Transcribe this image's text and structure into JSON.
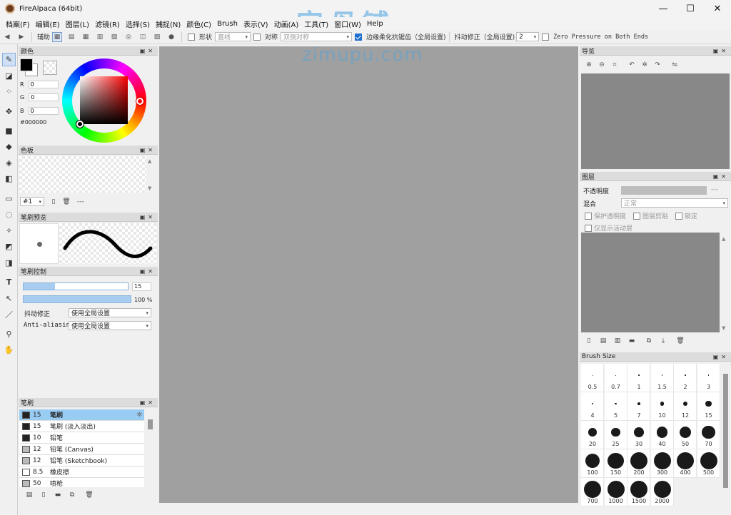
{
  "window": {
    "title": "FireAlpaca (64bit)",
    "minimize": "—",
    "maximize": "☐",
    "close": "✕"
  },
  "menu": [
    "档案(F)",
    "编辑(E)",
    "图层(L)",
    "滤镜(R)",
    "选择(S)",
    "捕捉(N)",
    "颜色(C)",
    "Brush",
    "表示(V)",
    "动画(A)",
    "工具(T)",
    "窗口(W)",
    "Help"
  ],
  "toolbar": {
    "assist_label": "辅助",
    "shape_label": "形状",
    "shape_value": "直线",
    "symmetry_label": "对称",
    "symmetry_value": "双侧对称",
    "edge_aa_label": "边缘柔化抗锯齿（全局设置)",
    "stabilizer_label": "抖动修正（全局设置)",
    "stabilizer_value": "2",
    "zero_pressure_label": "Zero Pressure on Both Ends"
  },
  "watermark": {
    "line1": "字母铺",
    "line2": "zimupu.com"
  },
  "color_panel": {
    "title": "颜色",
    "r_label": "R",
    "r": "0",
    "g_label": "G",
    "g": "0",
    "b_label": "B",
    "b": "0",
    "hex": "#000000"
  },
  "palette_panel": {
    "title": "色板",
    "selector": "#1",
    "dashes": "---"
  },
  "brush_preview_panel": {
    "title": "笔刷预览"
  },
  "brush_control_panel": {
    "title": "笔刷控制",
    "size_value": "15",
    "size_fill": 0.3,
    "opacity_value": "100",
    "opacity_unit": "%",
    "opacity_fill": 1.0,
    "stabilizer_label": "抖动修正",
    "stabilizer_value": "使用全局设置",
    "aa_label": "Anti-aliasin",
    "aa_value": "使用全局设置"
  },
  "brush_list_panel": {
    "title": "笔刷",
    "items": [
      {
        "size": "15",
        "name": "笔刷",
        "color": "#222222",
        "selected": true
      },
      {
        "size": "15",
        "name": "笔刷 (淡入淡出)",
        "color": "#222222",
        "selected": false
      },
      {
        "size": "10",
        "name": "铅笔",
        "color": "#222222",
        "selected": false
      },
      {
        "size": "12",
        "name": "铅笔 (Canvas)",
        "color": "#bbbbbb",
        "selected": false
      },
      {
        "size": "12",
        "name": "铅笔 (Sketchbook)",
        "color": "#bbbbbb",
        "selected": false
      },
      {
        "size": "8.5",
        "name": "橡皮擦",
        "color": "#ffffff",
        "selected": false
      },
      {
        "size": "50",
        "name": "喷枪",
        "color": "#bbbbbb",
        "selected": false
      }
    ]
  },
  "navigator_panel": {
    "title": "导览"
  },
  "layer_panel": {
    "title": "图层",
    "opacity_label": "不透明度",
    "opacity_value": "---",
    "blend_label": "混合",
    "blend_value": "正常",
    "protect_alpha": "保护透明度",
    "clipping": "图层剪贴",
    "lock": "锁定",
    "show_active_only": "仅显示活动层"
  },
  "brush_size_panel": {
    "title": "Brush Size",
    "sizes": [
      {
        "label": "0.5",
        "d": 0.5
      },
      {
        "label": "0.7",
        "d": 0.7
      },
      {
        "label": "1",
        "d": 1
      },
      {
        "label": "1.5",
        "d": 1.5
      },
      {
        "label": "2",
        "d": 2
      },
      {
        "label": "3",
        "d": 3
      },
      {
        "label": "4",
        "d": 4
      },
      {
        "label": "5",
        "d": 5
      },
      {
        "label": "7",
        "d": 7
      },
      {
        "label": "10",
        "d": 10
      },
      {
        "label": "12",
        "d": 12
      },
      {
        "label": "15",
        "d": 15
      },
      {
        "label": "20",
        "d": 20
      },
      {
        "label": "25",
        "d": 25
      },
      {
        "label": "30",
        "d": 30
      },
      {
        "label": "40",
        "d": 40
      },
      {
        "label": "50",
        "d": 50
      },
      {
        "label": "70",
        "d": 70
      },
      {
        "label": "100",
        "d": 100
      },
      {
        "label": "150",
        "d": 150
      },
      {
        "label": "200",
        "d": 200
      },
      {
        "label": "300",
        "d": 300
      },
      {
        "label": "400",
        "d": 400
      },
      {
        "label": "500",
        "d": 500
      },
      {
        "label": "700",
        "d": 700
      },
      {
        "label": "1000",
        "d": 1000
      },
      {
        "label": "1500",
        "d": 1500
      },
      {
        "label": "2000",
        "d": 2000
      }
    ]
  }
}
